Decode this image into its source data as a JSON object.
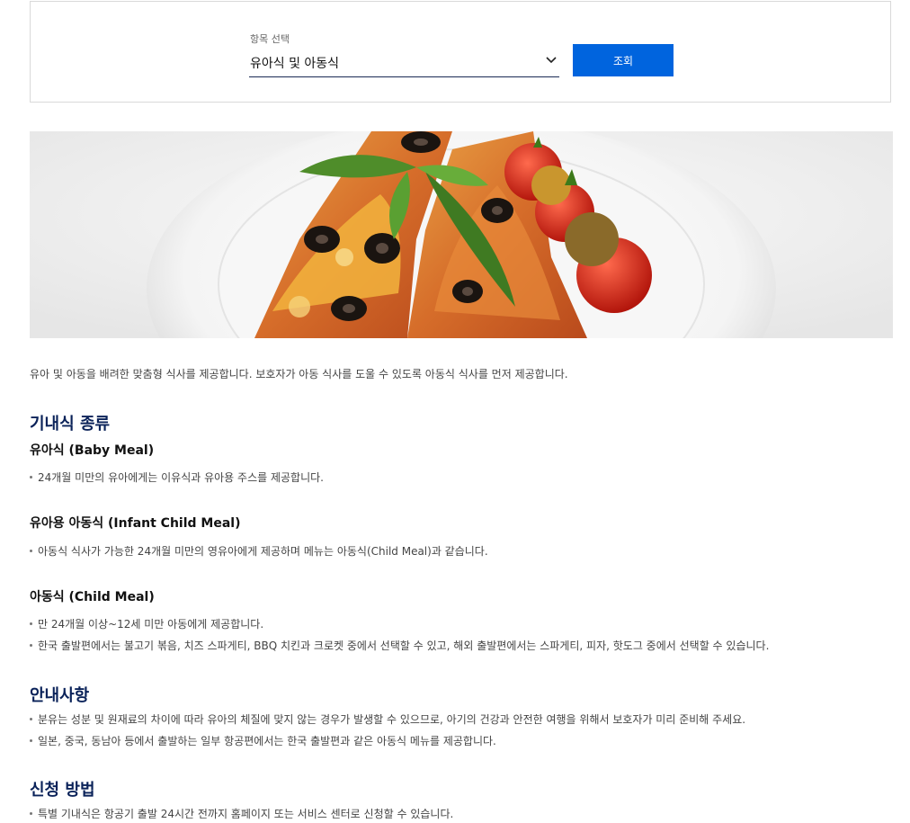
{
  "selector": {
    "label": "항목 선택",
    "value": "유아식 및 아동식",
    "button_label": "조회"
  },
  "intro": "유아 및 아동을 배려한 맞춤형 식사를 제공합니다. 보호자가 아동 식사를 도울 수 있도록 아동식 식사를 먼저 제공합니다.",
  "section_meals": {
    "title": "기내식 종류",
    "baby": {
      "title": "유아식 (Baby Meal)",
      "items": [
        "24개월 미만의 유아에게는 이유식과 유아용 주스를 제공합니다."
      ]
    },
    "infant_child": {
      "title": "유아용 아동식 (Infant Child Meal)",
      "items": [
        "아동식 식사가 가능한 24개월 미만의 영유아에게 제공하며 메뉴는 아동식(Child Meal)과 같습니다."
      ]
    },
    "child": {
      "title": "아동식 (Child Meal)",
      "items": [
        "만 24개월 이상~12세 미만 아동에게 제공합니다.",
        "한국 출발편에서는 불고기 볶음, 치즈 스파게티, BBQ 치킨과 크로켓 중에서 선택할 수 있고, 해외 출발편에서는 스파게티, 피자, 핫도그 중에서 선택할 수 있습니다."
      ]
    }
  },
  "section_notice": {
    "title": "안내사항",
    "items": [
      "분유는 성분 및 원재료의 차이에 따라 유아의 체질에 맞지 않는 경우가 발생할 수 있으므로, 아기의 건강과 안전한 여행을 위해서 보호자가 미리 준비해 주세요.",
      "일본, 중국, 동남아 등에서 출발하는 일부 항공편에서는 한국 출발편과 같은 아동식 메뉴를 제공합니다."
    ]
  },
  "section_apply": {
    "title": "신청 방법",
    "items": [
      "특별 기내식은 항공기 출발 24시간 전까지 홈페이지 또는 서비스 센터로 신청할 수 있습니다."
    ]
  },
  "colors": {
    "accent_button": "#0064de",
    "heading": "#0a2259"
  },
  "icons": [
    "chevron-down-icon"
  ]
}
